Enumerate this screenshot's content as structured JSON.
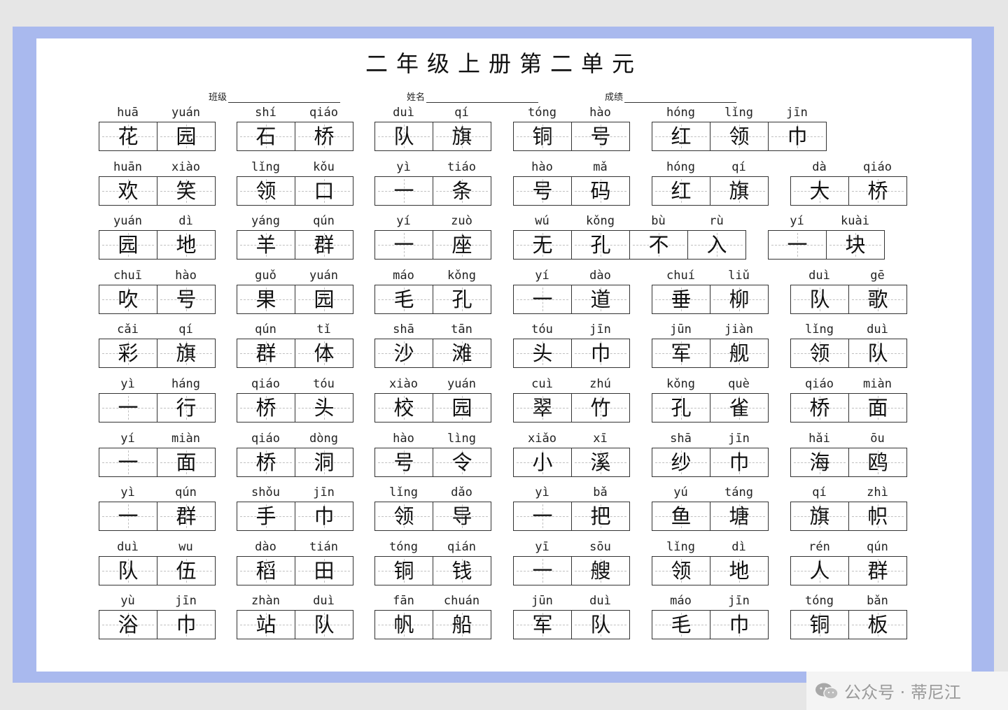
{
  "title": "二年级上册第二单元",
  "info": {
    "class_label": "班级",
    "name_label": "姓名",
    "score_label": "成绩"
  },
  "watermark": "公众号 · 蒂尼江",
  "rows": [
    [
      {
        "pinyin": [
          "huā",
          "yuán"
        ],
        "chars": [
          "花",
          "园"
        ]
      },
      {
        "pinyin": [
          "shí",
          "qiáo"
        ],
        "chars": [
          "石",
          "桥"
        ]
      },
      {
        "pinyin": [
          "duì",
          "qí"
        ],
        "chars": [
          "队",
          "旗"
        ]
      },
      {
        "pinyin": [
          "tóng",
          "hào"
        ],
        "chars": [
          "铜",
          "号"
        ]
      },
      {
        "pinyin": [
          "hóng",
          "lǐng",
          "jīn"
        ],
        "chars": [
          "红",
          "领",
          "巾"
        ]
      }
    ],
    [
      {
        "pinyin": [
          "huān",
          "xiào"
        ],
        "chars": [
          "欢",
          "笑"
        ]
      },
      {
        "pinyin": [
          "lǐng",
          "kǒu"
        ],
        "chars": [
          "领",
          "口"
        ]
      },
      {
        "pinyin": [
          "yì",
          "tiáo"
        ],
        "chars": [
          "一",
          "条"
        ]
      },
      {
        "pinyin": [
          "hào",
          "mǎ"
        ],
        "chars": [
          "号",
          "码"
        ]
      },
      {
        "pinyin": [
          "hóng",
          "qí"
        ],
        "chars": [
          "红",
          "旗"
        ]
      },
      {
        "pinyin": [
          "dà",
          "qiáo"
        ],
        "chars": [
          "大",
          "桥"
        ]
      }
    ],
    [
      {
        "pinyin": [
          "yuán",
          "dì"
        ],
        "chars": [
          "园",
          "地"
        ]
      },
      {
        "pinyin": [
          "yáng",
          "qún"
        ],
        "chars": [
          "羊",
          "群"
        ]
      },
      {
        "pinyin": [
          "yí",
          "zuò"
        ],
        "chars": [
          "一",
          "座"
        ]
      },
      {
        "pinyin": [
          "wú",
          "kǒng",
          "bù",
          "rù"
        ],
        "chars": [
          "无",
          "孔",
          "不",
          "入"
        ]
      },
      {
        "pinyin": [
          "yí",
          "kuài"
        ],
        "chars": [
          "一",
          "块"
        ]
      }
    ],
    [
      {
        "pinyin": [
          "chuī",
          "hào"
        ],
        "chars": [
          "吹",
          "号"
        ]
      },
      {
        "pinyin": [
          "guǒ",
          "yuán"
        ],
        "chars": [
          "果",
          "园"
        ]
      },
      {
        "pinyin": [
          "máo",
          "kǒng"
        ],
        "chars": [
          "毛",
          "孔"
        ]
      },
      {
        "pinyin": [
          "yí",
          "dào"
        ],
        "chars": [
          "一",
          "道"
        ]
      },
      {
        "pinyin": [
          "chuí",
          "liǔ"
        ],
        "chars": [
          "垂",
          "柳"
        ]
      },
      {
        "pinyin": [
          "duì",
          "gē"
        ],
        "chars": [
          "队",
          "歌"
        ]
      }
    ],
    [
      {
        "pinyin": [
          "cǎi",
          "qí"
        ],
        "chars": [
          "彩",
          "旗"
        ]
      },
      {
        "pinyin": [
          "qún",
          "tǐ"
        ],
        "chars": [
          "群",
          "体"
        ]
      },
      {
        "pinyin": [
          "shā",
          "tān"
        ],
        "chars": [
          "沙",
          "滩"
        ]
      },
      {
        "pinyin": [
          "tóu",
          "jīn"
        ],
        "chars": [
          "头",
          "巾"
        ]
      },
      {
        "pinyin": [
          "jūn",
          "jiàn"
        ],
        "chars": [
          "军",
          "舰"
        ]
      },
      {
        "pinyin": [
          "lǐng",
          "duì"
        ],
        "chars": [
          "领",
          "队"
        ]
      }
    ],
    [
      {
        "pinyin": [
          "yì",
          "háng"
        ],
        "chars": [
          "一",
          "行"
        ]
      },
      {
        "pinyin": [
          "qiáo",
          "tóu"
        ],
        "chars": [
          "桥",
          "头"
        ]
      },
      {
        "pinyin": [
          "xiào",
          "yuán"
        ],
        "chars": [
          "校",
          "园"
        ]
      },
      {
        "pinyin": [
          "cuì",
          "zhú"
        ],
        "chars": [
          "翠",
          "竹"
        ]
      },
      {
        "pinyin": [
          "kǒng",
          "què"
        ],
        "chars": [
          "孔",
          "雀"
        ]
      },
      {
        "pinyin": [
          "qiáo",
          "miàn"
        ],
        "chars": [
          "桥",
          "面"
        ]
      }
    ],
    [
      {
        "pinyin": [
          "yí",
          "miàn"
        ],
        "chars": [
          "一",
          "面"
        ]
      },
      {
        "pinyin": [
          "qiáo",
          "dòng"
        ],
        "chars": [
          "桥",
          "洞"
        ]
      },
      {
        "pinyin": [
          "hào",
          "lìng"
        ],
        "chars": [
          "号",
          "令"
        ]
      },
      {
        "pinyin": [
          "xiǎo",
          "xī"
        ],
        "chars": [
          "小",
          "溪"
        ]
      },
      {
        "pinyin": [
          "shā",
          "jīn"
        ],
        "chars": [
          "纱",
          "巾"
        ]
      },
      {
        "pinyin": [
          "hǎi",
          "ōu"
        ],
        "chars": [
          "海",
          "鸥"
        ]
      }
    ],
    [
      {
        "pinyin": [
          "yì",
          "qún"
        ],
        "chars": [
          "一",
          "群"
        ]
      },
      {
        "pinyin": [
          "shǒu",
          "jīn"
        ],
        "chars": [
          "手",
          "巾"
        ]
      },
      {
        "pinyin": [
          "lǐng",
          "dǎo"
        ],
        "chars": [
          "领",
          "导"
        ]
      },
      {
        "pinyin": [
          "yì",
          "bǎ"
        ],
        "chars": [
          "一",
          "把"
        ]
      },
      {
        "pinyin": [
          "yú",
          "táng"
        ],
        "chars": [
          "鱼",
          "塘"
        ]
      },
      {
        "pinyin": [
          "qí",
          "zhì"
        ],
        "chars": [
          "旗",
          "帜"
        ]
      }
    ],
    [
      {
        "pinyin": [
          "duì",
          "wu"
        ],
        "chars": [
          "队",
          "伍"
        ]
      },
      {
        "pinyin": [
          "dào",
          "tián"
        ],
        "chars": [
          "稻",
          "田"
        ]
      },
      {
        "pinyin": [
          "tóng",
          "qián"
        ],
        "chars": [
          "铜",
          "钱"
        ]
      },
      {
        "pinyin": [
          "yī",
          "sōu"
        ],
        "chars": [
          "一",
          "艘"
        ]
      },
      {
        "pinyin": [
          "lǐng",
          "dì"
        ],
        "chars": [
          "领",
          "地"
        ]
      },
      {
        "pinyin": [
          "rén",
          "qún"
        ],
        "chars": [
          "人",
          "群"
        ]
      }
    ],
    [
      {
        "pinyin": [
          "yù",
          "jīn"
        ],
        "chars": [
          "浴",
          "巾"
        ]
      },
      {
        "pinyin": [
          "zhàn",
          "duì"
        ],
        "chars": [
          "站",
          "队"
        ]
      },
      {
        "pinyin": [
          "fān",
          "chuán"
        ],
        "chars": [
          "帆",
          "船"
        ]
      },
      {
        "pinyin": [
          "jūn",
          "duì"
        ],
        "chars": [
          "军",
          "队"
        ]
      },
      {
        "pinyin": [
          "máo",
          "jīn"
        ],
        "chars": [
          "毛",
          "巾"
        ]
      },
      {
        "pinyin": [
          "tóng",
          "bǎn"
        ],
        "chars": [
          "铜",
          "板"
        ]
      }
    ]
  ]
}
